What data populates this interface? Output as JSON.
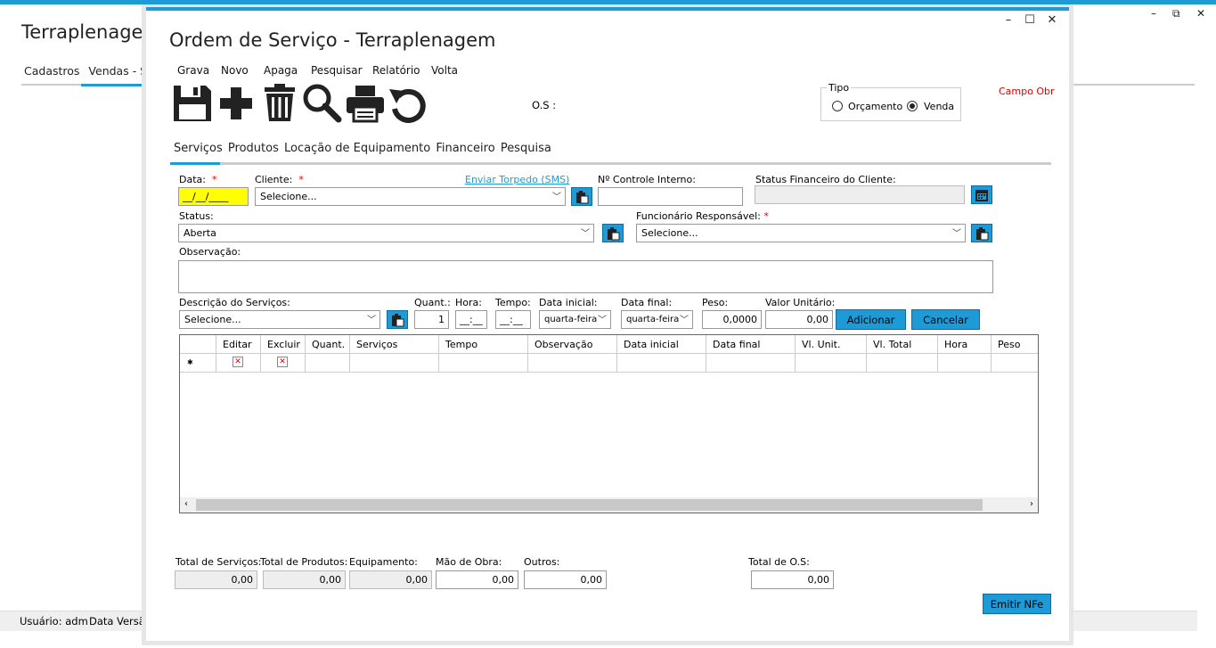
{
  "background": {
    "title": "Terraplenagem",
    "menu": [
      "Cadastros",
      "Vendas - Se"
    ],
    "status": {
      "user": "Usuário: adm",
      "date": "Data",
      "version": "Versão"
    }
  },
  "window": {
    "title": "Ordem de Serviço - Terraplenagem",
    "controls": {
      "minimize": "–",
      "maximize": "☐",
      "close": "✕"
    }
  },
  "menu": [
    "Grava",
    "Novo",
    "Apaga",
    "Pesquisar",
    "Relatório",
    "Volta"
  ],
  "toolbar_icons": [
    "save-icon",
    "plus-icon",
    "trash-icon",
    "search-icon",
    "print-icon",
    "undo-icon"
  ],
  "os_label": "O.S :",
  "tipo": {
    "legend": "Tipo",
    "options": [
      "Orçamento",
      "Venda"
    ],
    "selected": "Venda"
  },
  "campo_obrigatorio": "Campo Obr",
  "tabs": [
    "Serviços",
    "Produtos",
    "Locação de Equipamento",
    "Financeiro",
    "Pesquisa"
  ],
  "active_tab": "Serviços",
  "form": {
    "data_label": "Data:",
    "data_value": "__/__/____",
    "cliente_label": "Cliente:",
    "cliente_value": "Selecione...",
    "torpedo_link": "Enviar Torpedo (SMS)",
    "controle_label": "Nº Controle Interno:",
    "controle_value": "",
    "status_fin_label": "Status Financeiro do Cliente:",
    "status_fin_value": "",
    "status_label": "Status:",
    "status_value": "Aberta",
    "func_label": "Funcionário Responsável:",
    "func_value": "Selecione...",
    "obs_label": "Observação:",
    "obs_value": "",
    "required_mark": "*"
  },
  "service_entry": {
    "desc_label": "Descrição do Serviços:",
    "desc_value": "Selecione...",
    "quant_label": "Quant.:",
    "quant_value": "1",
    "hora_label": "Hora:",
    "hora_value": "__:__",
    "tempo_label": "Tempo:",
    "tempo_value": "__:__",
    "data_ini_label": "Data inicial:",
    "data_ini_value": "quarta-feira",
    "data_fim_label": "Data final:",
    "data_fim_value": "quarta-feira",
    "peso_label": "Peso:",
    "peso_value": "0,0000",
    "valor_label": "Valor Unitário:",
    "valor_value": "0,00",
    "add_button": "Adicionar",
    "cancel_button": "Cancelar"
  },
  "grid": {
    "columns": [
      "",
      "Editar",
      "Excluir",
      "Quant.",
      "Serviços",
      "Tempo",
      "Observação",
      "Data inicial",
      "Data final",
      "Vl. Unit.",
      "Vl. Total",
      "Hora",
      "Peso"
    ],
    "new_row_marker": "✱"
  },
  "totals": {
    "servicos_label": "Total de Serviços:",
    "servicos_value": "0,00",
    "produtos_label": "Total de Produtos:",
    "produtos_value": "0,00",
    "equip_label": "Equipamento:",
    "equip_value": "0,00",
    "mao_label": "Mão de Obra:",
    "mao_value": "0,00",
    "outros_label": "Outros:",
    "outros_value": "0,00",
    "os_label": "Total de O.S:",
    "os_value": "0,00"
  },
  "emitir_button": "Emitir NFe",
  "colors": {
    "accent": "#1e9bd7",
    "required": "#e00000",
    "highlight": "#ffff00"
  }
}
